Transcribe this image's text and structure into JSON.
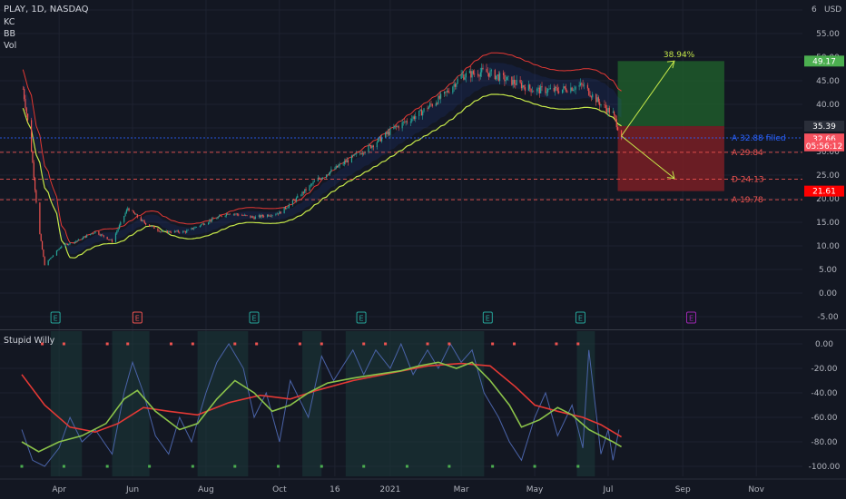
{
  "header": {
    "symbol_line": "PLAY, 1D, NASDAQ",
    "indicators": [
      "KC",
      "BB",
      "Vol"
    ],
    "currency": "USD"
  },
  "colors": {
    "background": "#131722",
    "grid": "#1e2230",
    "axis_text": "#b2b5be",
    "candle_up": "#26a69a",
    "candle_down": "#ef5350",
    "kc_band": "#2962ff",
    "bb_upper": "#e53935",
    "bb_lower": "#c6e84a",
    "profit_zone": "#1e5a2a",
    "loss_zone": "#7a1f24",
    "osc_line": "#4a63a8",
    "osc_fast": "#8bc34a",
    "osc_slow": "#e53935"
  },
  "chart_data": [
    {
      "type": "candlestick",
      "title": "PLAY, 1D, NASDAQ",
      "xlabel": "",
      "ylabel": "",
      "ylim": [
        -5,
        60
      ],
      "x_range": [
        "2020-03-01",
        "2021-11-15"
      ],
      "y_ticks": [
        "60.00",
        "55.00",
        "50.00",
        "45.00",
        "40.00",
        "35.00",
        "30.00",
        "25.00",
        "20.00",
        "15.00",
        "10.00",
        "5.00",
        "0.00",
        "-5.00"
      ],
      "x_ticks": [
        "Apr",
        "Jun",
        "Aug",
        "Oct",
        "16",
        "2021",
        "Mar",
        "May",
        "Jul",
        "Sep",
        "Nov"
      ],
      "grid": true,
      "legend": "none",
      "close_path": [
        [
          "2020-03-01",
          45
        ],
        [
          "2020-03-08",
          33
        ],
        [
          "2020-03-15",
          14
        ],
        [
          "2020-03-20",
          6
        ],
        [
          "2020-03-27",
          8
        ],
        [
          "2020-04-03",
          10
        ],
        [
          "2020-04-15",
          11
        ],
        [
          "2020-05-01",
          13
        ],
        [
          "2020-05-15",
          11
        ],
        [
          "2020-05-28",
          18
        ],
        [
          "2020-06-10",
          15
        ],
        [
          "2020-06-25",
          13
        ],
        [
          "2020-07-15",
          13
        ],
        [
          "2020-08-01",
          15
        ],
        [
          "2020-08-20",
          17
        ],
        [
          "2020-09-10",
          16
        ],
        [
          "2020-10-01",
          17
        ],
        [
          "2020-10-15",
          20
        ],
        [
          "2020-11-01",
          24
        ],
        [
          "2020-11-20",
          27
        ],
        [
          "2020-12-15",
          31
        ],
        [
          "2021-01-05",
          35
        ],
        [
          "2021-01-25",
          38
        ],
        [
          "2021-02-15",
          42
        ],
        [
          "2021-03-01",
          46
        ],
        [
          "2021-03-20",
          47
        ],
        [
          "2021-04-10",
          45
        ],
        [
          "2021-05-01",
          43
        ],
        [
          "2021-05-20",
          43
        ],
        [
          "2021-06-10",
          44
        ],
        [
          "2021-06-25",
          40
        ],
        [
          "2021-07-05",
          38
        ],
        [
          "2021-07-12",
          33
        ]
      ],
      "price_labels": [
        {
          "text": "49.17",
          "value": 49.17,
          "color": "#4caf50"
        },
        {
          "text": "35.39",
          "value": 35.39,
          "color": "#2a2e39"
        },
        {
          "text": "32.66",
          "value": 32.66,
          "color": "#f7525f"
        },
        {
          "text": "05:56:12",
          "value": 31.2,
          "color": "#f7525f"
        },
        {
          "text": "21.61",
          "value": 21.61,
          "color": "#ff0000"
        }
      ],
      "levels": [
        {
          "text": "A 32.88 filled",
          "value": 32.88,
          "color": "#2962ff"
        },
        {
          "text": "A 29.84",
          "value": 29.84,
          "color": "#ef5350"
        },
        {
          "text": "D 24.13",
          "value": 24.13,
          "color": "#ef5350"
        },
        {
          "text": "A 19.78",
          "value": 19.78,
          "color": "#ef5350"
        }
      ],
      "projection": {
        "entry": [
          "2021-07-12",
          33.3
        ],
        "up_target": [
          "2021-08-25",
          49.2
        ],
        "up_label": "38.94%",
        "down_target": [
          "2021-08-25",
          24.3
        ],
        "zone_top": 49.17,
        "zone_mid": 35.39,
        "zone_bottom": 21.61
      },
      "earnings_markers": [
        {
          "date": "2020-03-29",
          "label": "E",
          "color": "#26a69a"
        },
        {
          "date": "2020-06-05",
          "label": "E",
          "color": "#ef5350"
        },
        {
          "date": "2020-09-10",
          "label": "E",
          "color": "#26a69a"
        },
        {
          "date": "2020-12-08",
          "label": "E",
          "color": "#26a69a"
        },
        {
          "date": "2021-03-23",
          "label": "E",
          "color": "#26a69a"
        },
        {
          "date": "2021-06-08",
          "label": "E",
          "color": "#26a69a"
        },
        {
          "date": "2021-09-08",
          "label": "E",
          "color": "#9c27b0"
        }
      ]
    },
    {
      "type": "line",
      "title": "Stupid Willy",
      "ylim": [
        -105,
        5
      ],
      "y_ticks": [
        "0.00",
        "-20.00",
        "-40.00",
        "-60.00",
        "-80.00",
        "-100.00"
      ],
      "grid": true,
      "series": [
        {
          "color": "#8bc34a",
          "points": [
            [
              "2020-03-01",
              -80
            ],
            [
              "2020-03-15",
              -88
            ],
            [
              "2020-04-01",
              -80
            ],
            [
              "2020-04-20",
              -75
            ],
            [
              "2020-05-10",
              -65
            ],
            [
              "2020-05-25",
              -45
            ],
            [
              "2020-06-05",
              -38
            ],
            [
              "2020-06-20",
              -55
            ],
            [
              "2020-07-10",
              -70
            ],
            [
              "2020-07-25",
              -65
            ],
            [
              "2020-08-10",
              -45
            ],
            [
              "2020-08-25",
              -30
            ],
            [
              "2020-09-10",
              -40
            ],
            [
              "2020-09-25",
              -55
            ],
            [
              "2020-10-10",
              -50
            ],
            [
              "2020-10-25",
              -40
            ],
            [
              "2020-11-10",
              -32
            ],
            [
              "2020-12-01",
              -28
            ],
            [
              "2020-12-20",
              -25
            ],
            [
              "2021-01-10",
              -22
            ],
            [
              "2021-01-25",
              -18
            ],
            [
              "2021-02-10",
              -15
            ],
            [
              "2021-02-25",
              -20
            ],
            [
              "2021-03-10",
              -15
            ],
            [
              "2021-03-25",
              -30
            ],
            [
              "2021-04-10",
              -50
            ],
            [
              "2021-04-20",
              -68
            ],
            [
              "2021-05-05",
              -62
            ],
            [
              "2021-05-20",
              -52
            ],
            [
              "2021-06-01",
              -58
            ],
            [
              "2021-06-15",
              -70
            ],
            [
              "2021-06-25",
              -75
            ],
            [
              "2021-07-05",
              -80
            ],
            [
              "2021-07-12",
              -84
            ]
          ]
        },
        {
          "color": "#e53935",
          "points": [
            [
              "2020-03-01",
              -25
            ],
            [
              "2020-03-20",
              -50
            ],
            [
              "2020-04-10",
              -68
            ],
            [
              "2020-05-01",
              -72
            ],
            [
              "2020-05-20",
              -65
            ],
            [
              "2020-06-10",
              -52
            ],
            [
              "2020-07-01",
              -55
            ],
            [
              "2020-07-25",
              -58
            ],
            [
              "2020-08-20",
              -48
            ],
            [
              "2020-09-15",
              -42
            ],
            [
              "2020-10-10",
              -45
            ],
            [
              "2020-11-01",
              -38
            ],
            [
              "2020-12-01",
              -30
            ],
            [
              "2021-01-01",
              -24
            ],
            [
              "2021-02-01",
              -18
            ],
            [
              "2021-03-01",
              -16
            ],
            [
              "2021-03-25",
              -18
            ],
            [
              "2021-04-15",
              -35
            ],
            [
              "2021-05-01",
              -50
            ],
            [
              "2021-05-20",
              -55
            ],
            [
              "2021-06-10",
              -60
            ],
            [
              "2021-06-25",
              -66
            ],
            [
              "2021-07-12",
              -76
            ]
          ]
        },
        {
          "color": "#4a63a8",
          "points": [
            [
              "2020-03-01",
              -70
            ],
            [
              "2020-03-10",
              -95
            ],
            [
              "2020-03-20",
              -100
            ],
            [
              "2020-04-01",
              -85
            ],
            [
              "2020-04-10",
              -60
            ],
            [
              "2020-04-20",
              -80
            ],
            [
              "2020-05-01",
              -70
            ],
            [
              "2020-05-15",
              -90
            ],
            [
              "2020-05-25",
              -40
            ],
            [
              "2020-06-01",
              -15
            ],
            [
              "2020-06-10",
              -40
            ],
            [
              "2020-06-20",
              -75
            ],
            [
              "2020-07-01",
              -90
            ],
            [
              "2020-07-10",
              -60
            ],
            [
              "2020-07-20",
              -80
            ],
            [
              "2020-08-01",
              -40
            ],
            [
              "2020-08-10",
              -15
            ],
            [
              "2020-08-20",
              0
            ],
            [
              "2020-09-01",
              -20
            ],
            [
              "2020-09-10",
              -60
            ],
            [
              "2020-09-20",
              -40
            ],
            [
              "2020-10-01",
              -80
            ],
            [
              "2020-10-10",
              -30
            ],
            [
              "2020-10-25",
              -60
            ],
            [
              "2020-11-05",
              -10
            ],
            [
              "2020-11-15",
              -30
            ],
            [
              "2020-12-01",
              -5
            ],
            [
              "2020-12-10",
              -25
            ],
            [
              "2020-12-20",
              -5
            ],
            [
              "2021-01-01",
              -20
            ],
            [
              "2021-01-10",
              0
            ],
            [
              "2021-01-20",
              -25
            ],
            [
              "2021-02-01",
              -5
            ],
            [
              "2021-02-10",
              -20
            ],
            [
              "2021-02-20",
              0
            ],
            [
              "2021-03-01",
              -15
            ],
            [
              "2021-03-10",
              -5
            ],
            [
              "2021-03-20",
              -40
            ],
            [
              "2021-04-01",
              -60
            ],
            [
              "2021-04-10",
              -80
            ],
            [
              "2021-04-20",
              -95
            ],
            [
              "2021-05-01",
              -60
            ],
            [
              "2021-05-10",
              -40
            ],
            [
              "2021-05-20",
              -75
            ],
            [
              "2021-06-01",
              -50
            ],
            [
              "2021-06-10",
              -85
            ],
            [
              "2021-06-15",
              -5
            ],
            [
              "2021-06-25",
              -90
            ],
            [
              "2021-07-01",
              -70
            ],
            [
              "2021-07-05",
              -95
            ],
            [
              "2021-07-10",
              -70
            ]
          ]
        }
      ]
    }
  ]
}
